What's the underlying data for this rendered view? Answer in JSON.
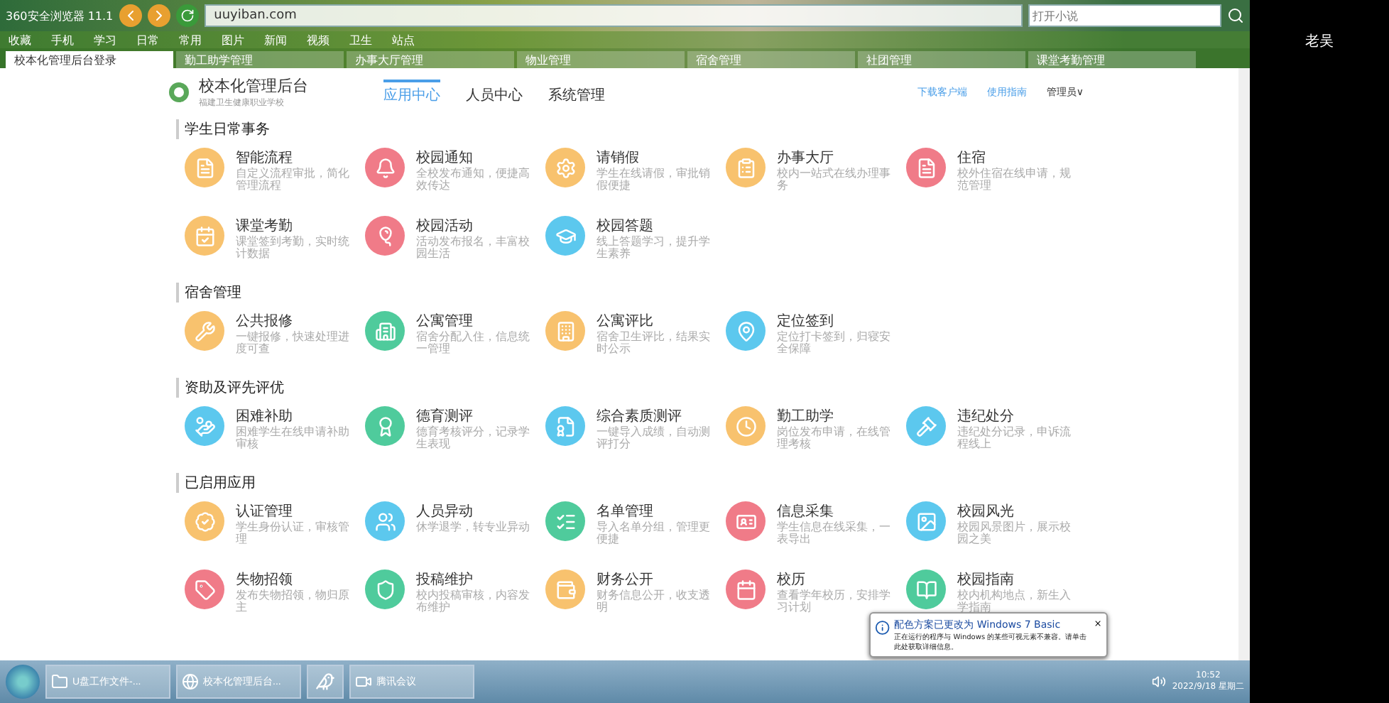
{
  "browser": {
    "title": "360安全浏览器 11.1",
    "address": "uuyiban.com",
    "search_placeholder": "打开小说",
    "bookmarks": [
      "收藏",
      "手机",
      "学习",
      "日常",
      "常用",
      "图片",
      "新闻",
      "视频",
      "卫生",
      "站点"
    ],
    "tabs": [
      {
        "label": "校本化管理后台登录",
        "selected": true
      },
      {
        "label": "勤工助学管理",
        "selected": false
      },
      {
        "label": "办事大厅管理",
        "selected": false
      },
      {
        "label": "物业管理",
        "selected": false
      },
      {
        "label": "宿舍管理",
        "selected": false
      },
      {
        "label": "社团管理",
        "selected": false
      },
      {
        "label": "课堂考勤管理",
        "selected": false
      }
    ]
  },
  "header": {
    "title": "校本化管理后台",
    "subtitle": "福建卫生健康职业学校",
    "nav": [
      {
        "label": "应用中心",
        "selected": true
      },
      {
        "label": "人员中心",
        "selected": false
      },
      {
        "label": "系统管理",
        "selected": false
      }
    ],
    "links": [
      "下载客户端",
      "使用指南"
    ],
    "user": "管理员∨"
  },
  "sections": [
    {
      "title": "学生日常事务",
      "apps": [
        {
          "name": "智能流程",
          "desc": "自定义流程审批，简化管理流程",
          "color": "#f8c26e"
        },
        {
          "name": "校园通知",
          "desc": "全校发布通知，便捷高效传达",
          "color": "#f07b88"
        },
        {
          "name": "请销假",
          "desc": "学生在线请假，审批销假便捷",
          "color": "#f8c26e"
        },
        {
          "name": "办事大厅",
          "desc": "校内一站式在线办理事务",
          "color": "#f8c26e"
        },
        {
          "name": "住宿",
          "desc": "校外住宿在线申请，规范管理",
          "color": "#f07b88"
        },
        {
          "name": "课堂考勤",
          "desc": "课堂签到考勤，实时统计数据",
          "color": "#f8c26e"
        },
        {
          "name": "校园活动",
          "desc": "活动发布报名，丰富校园生活",
          "color": "#f07b88"
        },
        {
          "name": "校园答题",
          "desc": "线上答题学习，提升学生素养",
          "color": "#5cc8ee"
        }
      ]
    },
    {
      "title": "宿舍管理",
      "apps": [
        {
          "name": "公共报修",
          "desc": "一键报修，快速处理进度可查",
          "color": "#f8c26e"
        },
        {
          "name": "公寓管理",
          "desc": "宿舍分配入住，信息统一管理",
          "color": "#4fcb9c"
        },
        {
          "name": "公寓评比",
          "desc": "宿舍卫生评比，结果实时公示",
          "color": "#f8c26e"
        },
        {
          "name": "定位签到",
          "desc": "定位打卡签到，归寝安全保障",
          "color": "#5cc8ee"
        }
      ]
    },
    {
      "title": "资助及评先评优",
      "apps": [
        {
          "name": "困难补助",
          "desc": "困难学生在线申请补助审核",
          "color": "#5cc8ee"
        },
        {
          "name": "德育测评",
          "desc": "德育考核评分，记录学生表现",
          "color": "#4fcb9c"
        },
        {
          "name": "综合素质测评",
          "desc": "一键导入成绩，自动测评打分",
          "color": "#5cc8ee"
        },
        {
          "name": "勤工助学",
          "desc": "岗位发布申请，在线管理考核",
          "color": "#f8c26e"
        },
        {
          "name": "违纪处分",
          "desc": "违纪处分记录，申诉流程线上",
          "color": "#5cc8ee"
        }
      ]
    },
    {
      "title": "已启用应用",
      "apps": [
        {
          "name": "认证管理",
          "desc": "学生身份认证，审核管理",
          "color": "#f8c26e"
        },
        {
          "name": "人员异动",
          "desc": "休学退学，转专业异动",
          "color": "#5cc8ee"
        },
        {
          "name": "名单管理",
          "desc": "导入名单分组，管理更便捷",
          "color": "#4fcb9c"
        },
        {
          "name": "信息采集",
          "desc": "学生信息在线采集，一表导出",
          "color": "#f07b88"
        },
        {
          "name": "校园风光",
          "desc": "校园风景图片，展示校园之美",
          "color": "#5cc8ee"
        },
        {
          "name": "失物招领",
          "desc": "发布失物招领，物归原主",
          "color": "#f07b88"
        },
        {
          "name": "投稿维护",
          "desc": "校内投稿审核，内容发布维护",
          "color": "#4fcb9c"
        },
        {
          "name": "财务公开",
          "desc": "财务信息公开，收支透明",
          "color": "#f8c26e"
        },
        {
          "name": "校历",
          "desc": "查看学年校历，安排学习计划",
          "color": "#f07b88"
        },
        {
          "name": "校园指南",
          "desc": "校内机构地点，新生入学指南",
          "color": "#4fcb9c"
        }
      ]
    }
  ],
  "notification": {
    "title": "配色方案已更改为 Windows 7 Basic",
    "body": "正在运行的程序与 Windows 的某些可视元素不兼容。请单击此处获取详细信息。"
  },
  "taskbar": {
    "items": [
      "U盘工作文件-...",
      "校本化管理后台...",
      "腾讯会议"
    ],
    "time": "10:52",
    "date": "2022/9/18 星期二"
  },
  "side": {
    "user": "老吴"
  }
}
